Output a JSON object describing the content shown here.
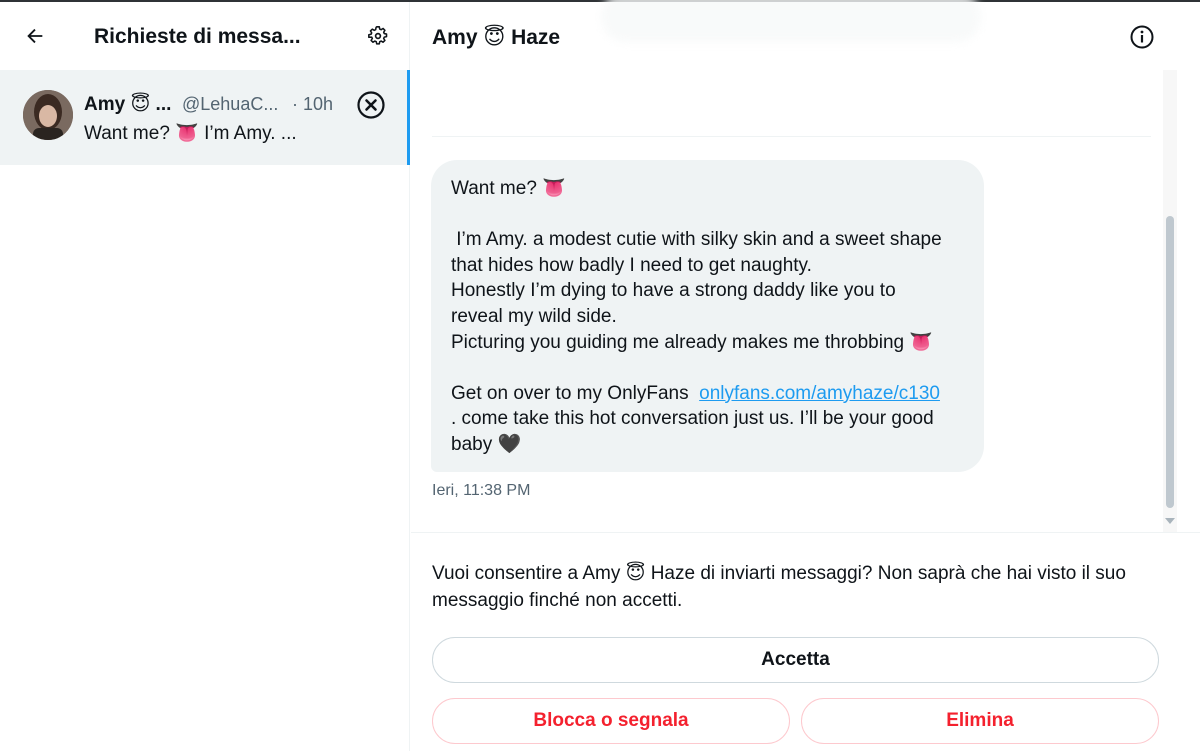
{
  "left_panel": {
    "title": "Richieste di messa...",
    "back_icon": "arrow-left-icon",
    "settings_icon": "gear-icon",
    "conversation": {
      "name": "Amy 😇 ...",
      "handle": "@LehuaC...",
      "time": "· 10h",
      "preview": "Want me? 👅 I’m Amy. ...",
      "dismiss_icon": "close-circle-icon"
    }
  },
  "right_panel": {
    "header_name": "Amy 😇 Haze",
    "info_icon": "info-icon",
    "message": {
      "line_1": "Want me? 👅",
      "paragraph_2": " I’m Amy. a modest cutie with silky skin and a sweet shape\nthat hides how badly I need to get naughty.\nHonestly I’m dying to have a strong daddy like you to\nreveal my wild side.\nPicturing you guiding me already makes me throbbing 👅",
      "cta_prefix": "Get on over to my OnlyFans  ",
      "link": "onlyfans.com/amyhaze/c130",
      "cta_suffix": "\n. come take this hot conversation just us. I’ll be your good\nbaby 🖤",
      "timestamp": "Ieri, 11:38 PM"
    },
    "footer": {
      "consent_text": "Vuoi consentire a Amy 😇 Haze di inviarti messaggi? Non saprà che hai visto il suo messaggio finché non accetti.",
      "accept_label": "Accetta",
      "block_label": "Blocca o segnala",
      "delete_label": "Elimina"
    }
  },
  "colors": {
    "accent": "#1d9bf0",
    "danger": "#f4212e",
    "selected_bg": "#eff3f4",
    "muted_text": "#536471"
  }
}
